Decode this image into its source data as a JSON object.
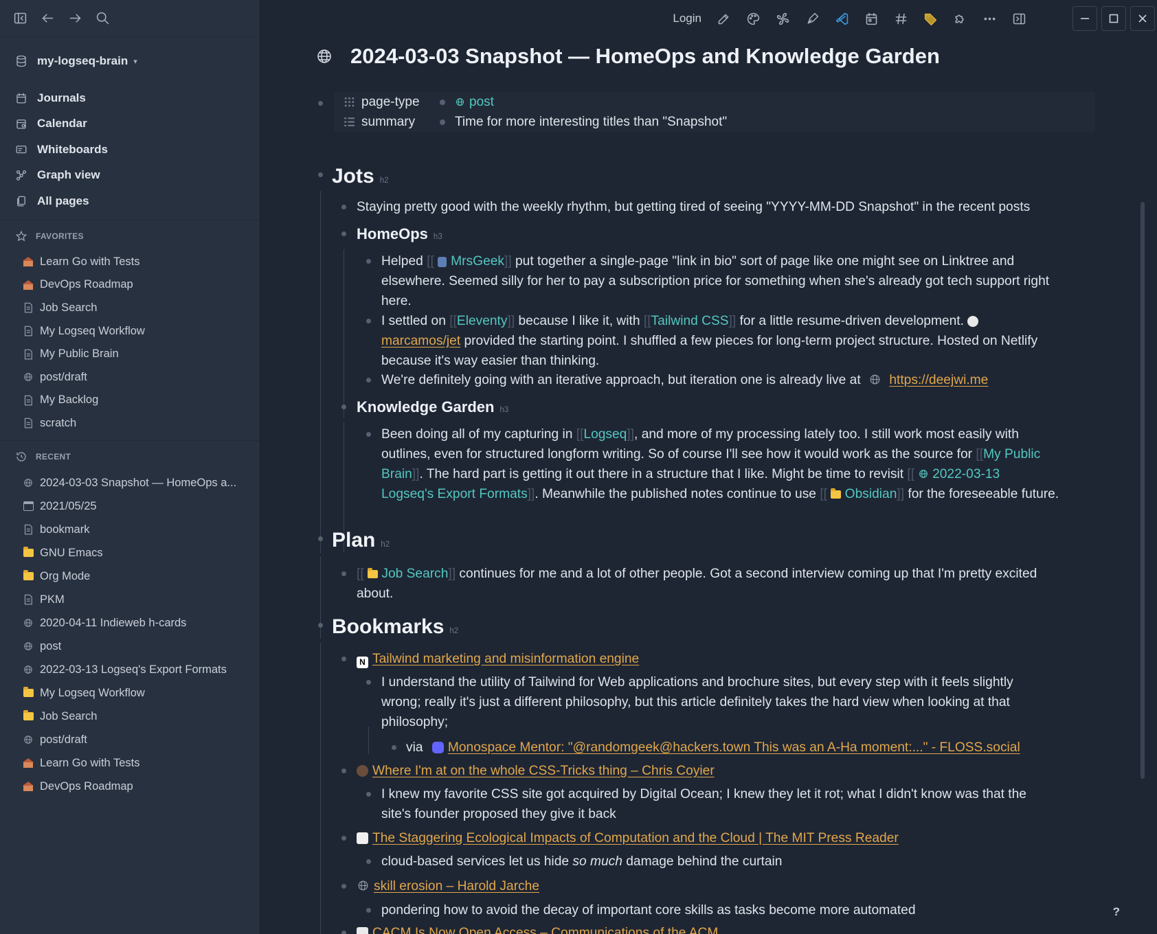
{
  "sidebar": {
    "graph_name": "my-logseq-brain",
    "nav": [
      {
        "label": "Journals",
        "icon": "calendar-days-icon"
      },
      {
        "label": "Calendar",
        "icon": "calendar-icon"
      },
      {
        "label": "Whiteboards",
        "icon": "whiteboard-icon"
      },
      {
        "label": "Graph view",
        "icon": "graph-icon"
      },
      {
        "label": "All pages",
        "icon": "pages-icon"
      }
    ],
    "favorites_label": "FAVORITES",
    "favorites": [
      {
        "label": "Learn Go with Tests",
        "icon": "school-icon"
      },
      {
        "label": "DevOps Roadmap",
        "icon": "school-icon"
      },
      {
        "label": "Job Search",
        "icon": "page-icon"
      },
      {
        "label": "My Logseq Workflow",
        "icon": "page-icon"
      },
      {
        "label": "My Public Brain",
        "icon": "page-icon"
      },
      {
        "label": "post/draft",
        "icon": "globe-icon"
      },
      {
        "label": "My Backlog",
        "icon": "page-icon"
      },
      {
        "label": "scratch",
        "icon": "page-icon"
      }
    ],
    "recent_label": "RECENT",
    "recent": [
      {
        "label": "2024-03-03 Snapshot — HomeOps a...",
        "icon": "globe-icon"
      },
      {
        "label": "2021/05/25",
        "icon": "calendar-icon"
      },
      {
        "label": "bookmark",
        "icon": "page-icon"
      },
      {
        "label": "GNU Emacs",
        "icon": "folder-icon"
      },
      {
        "label": "Org Mode",
        "icon": "folder-icon"
      },
      {
        "label": "PKM",
        "icon": "page-icon"
      },
      {
        "label": "2020-04-11 Indieweb h-cards",
        "icon": "globe-icon"
      },
      {
        "label": "post",
        "icon": "globe-icon"
      },
      {
        "label": "2022-03-13 Logseq's Export Formats",
        "icon": "globe-icon"
      },
      {
        "label": "My Logseq Workflow",
        "icon": "folder-icon"
      },
      {
        "label": "Job Search",
        "icon": "folder-icon"
      },
      {
        "label": "post/draft",
        "icon": "globe-icon"
      },
      {
        "label": "Learn Go with Tests",
        "icon": "school-icon"
      },
      {
        "label": "DevOps Roadmap",
        "icon": "school-icon"
      }
    ]
  },
  "topbar": {
    "login": "Login",
    "help": "?"
  },
  "page": {
    "title": "2024-03-03 Snapshot — HomeOps and Knowledge Garden",
    "props": {
      "type_key": "page-type",
      "type_val": "post",
      "summary_key": "summary",
      "summary_val": "Time for more interesting titles than \"Snapshot\""
    },
    "jots": {
      "heading": "Jots",
      "tag": "h2",
      "intro": "Staying pretty good with the weekly rhythm, but getting tired of seeing \"YYYY-MM-DD Snapshot\" in the recent posts",
      "homeops": {
        "heading": "HomeOps",
        "tag": "h3"
      },
      "b1a": "Helped",
      "b1link": "MrsGeek",
      "b1b": " put together a single-page \"link in bio\" sort of page like one might see on Linktree and",
      "b1c": "elsewhere. Seemed silly for her to pay a subscription price for something when she's already got tech support right",
      "b1d": "here.",
      "b2a": "I settled on",
      "b2link1": "Eleventy",
      "b2b": " because I like it, with",
      "b2link2": "Tailwind CSS",
      "b2c": " for a little resume-driven development.",
      "b2ext": "marcamos/jet",
      "b2d": " provided the starting point. I shuffled a few pieces for long-term project structure. Hosted on Netlify",
      "b2e": "because it's way easier than thinking.",
      "b3a": "We're definitely going with an iterative approach, but iteration one is already live at",
      "b3link": "https://deejwi.me",
      "kg": {
        "heading": "Knowledge Garden",
        "tag": "h3"
      },
      "k1a": "Been doing all of my capturing in",
      "k1link1": "Logseq",
      "k1b": ", and more of my processing lately too. I still work most easily with",
      "k1c": "outlines, even for structured longform writing. So of course I'll see how it would work as the source for",
      "k1link2a": "My Public",
      "k1link2b": "Brain",
      "k1d": ". The hard part is getting it out there in a structure that I like. Might be time to revisit",
      "k1link3a": "2022-03-13",
      "k1link3b": "Logseq's Export Formats",
      "k1e": ". Meanwhile the published notes continue to use",
      "k1link4": "Obsidian",
      "k1f": " for the foreseeable future."
    },
    "plan": {
      "heading": "Plan",
      "tag": "h2",
      "p1link": "Job Search",
      "p1a": " continues for me and a lot of other people. Got a second interview coming up that I'm pretty excited",
      "p1b": "about."
    },
    "bookmarks": {
      "heading": "Bookmarks",
      "tag": "h2",
      "bm1": "Tailwind marketing and misinformation engine",
      "bm1a": "I understand the utility of Tailwind for Web applications and brochure sites, but every step with it feels slightly",
      "bm1b": "wrong; really it's just a different philosophy, but this article definitely takes the hard view when looking at that",
      "bm1c": "philosophy;",
      "via": "via",
      "via_link": "Monospace Mentor: \"@randomgeek@hackers.town This was an A-Ha moment:...\" - FLOSS.social",
      "bm2": "Where I'm at on the whole CSS-Tricks thing – Chris Coyier",
      "bm2a": "I knew my favorite CSS site got acquired by Digital Ocean; I knew they let it rot; what I didn't know was that the",
      "bm2b": "site's founder proposed they give it back",
      "bm3": "The Staggering Ecological Impacts of Computation and the Cloud | The MIT Press Reader",
      "bm3a": "cloud-based services let us hide ",
      "bm3em": "so much",
      "bm3b": " damage behind the curtain",
      "bm4": "skill erosion – Harold Jarche",
      "bm4a": "pondering how to avoid the decay of important core skills as tasks become more automated",
      "bm5": "CACM Is Now Open Access – Communications of the ACM"
    }
  },
  "colors": {
    "accent_link": "#54c7c0",
    "external_link": "#e2a74a",
    "background": "#1e2634",
    "sidebar": "#283140"
  }
}
